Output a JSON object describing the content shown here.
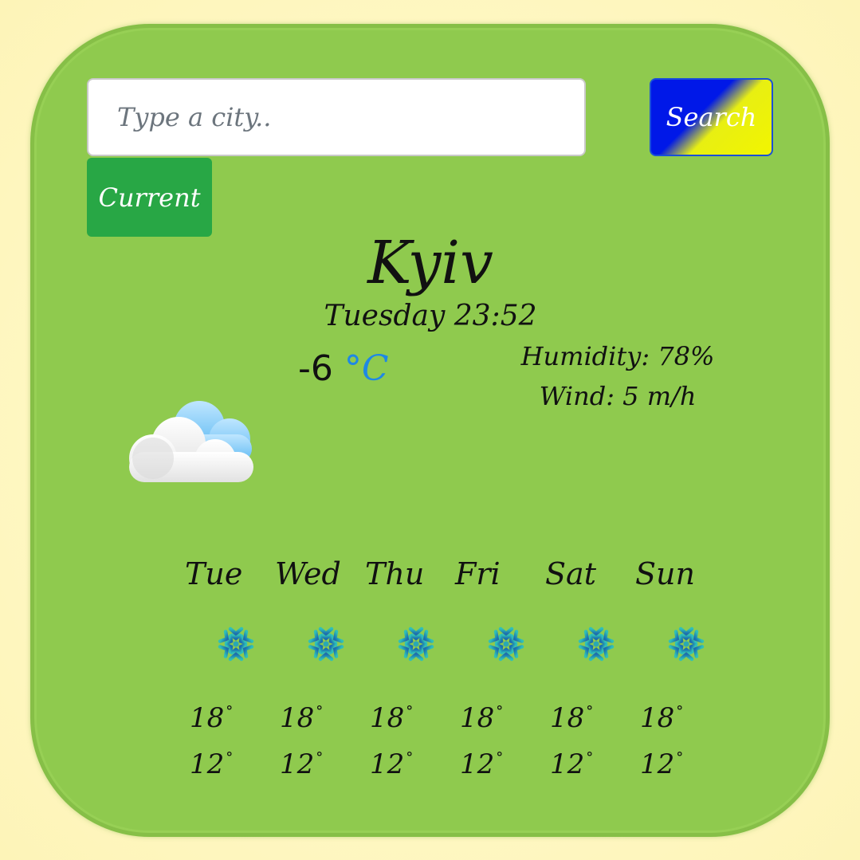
{
  "search": {
    "placeholder": "Type a city..",
    "button_label": "Search"
  },
  "current_button_label": "Current",
  "weather": {
    "city": "Kyiv",
    "datetime": "Tuesday 23:52",
    "temperature": "-6",
    "unit": "°C",
    "humidity": "Humidity: 78%",
    "wind": "Wind: 5 m/h",
    "icon": "cloud-icon"
  },
  "forecast": [
    {
      "day": "Tue",
      "icon": "snowflake-icon",
      "max": "18",
      "min": "12"
    },
    {
      "day": "Wed",
      "icon": "snowflake-icon",
      "max": "18",
      "min": "12"
    },
    {
      "day": "Thu",
      "icon": "snowflake-icon",
      "max": "18",
      "min": "12"
    },
    {
      "day": "Fri",
      "icon": "snowflake-icon",
      "max": "18",
      "min": "12"
    },
    {
      "day": "Sat",
      "icon": "snowflake-icon",
      "max": "18",
      "min": "12"
    },
    {
      "day": "Sun",
      "icon": "snowflake-icon",
      "max": "18",
      "min": "12"
    }
  ],
  "degree_symbol": "°",
  "colors": {
    "card": "#8fca4e",
    "current_button": "#28a745",
    "search_blue": "#0018e8",
    "search_yellow": "#f2f500",
    "unit_accent": "#1e88e5",
    "snowflake": "#1aa3a8"
  }
}
